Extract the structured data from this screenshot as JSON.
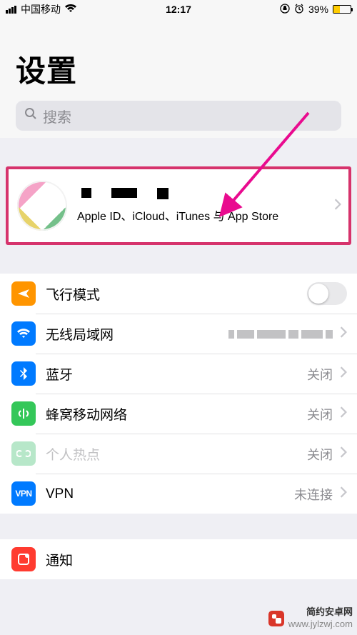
{
  "status": {
    "carrier": "中国移动",
    "signal_icon": "signal-icon",
    "wifi_icon": "wifi-icon",
    "time": "12:17",
    "lock_icon": "orientation-lock-icon",
    "alarm_icon": "alarm-icon",
    "battery_pct": "39%"
  },
  "header": {
    "title": "设置",
    "search_placeholder": "搜索"
  },
  "apple_id": {
    "subtitle": "Apple ID、iCloud、iTunes 与 App Store"
  },
  "rows": {
    "airplane": {
      "label": "飞行模式"
    },
    "wifi": {
      "label": "无线局域网"
    },
    "bluetooth": {
      "label": "蓝牙",
      "value": "关闭"
    },
    "cellular": {
      "label": "蜂窝移动网络",
      "value": "关闭"
    },
    "hotspot": {
      "label": "个人热点",
      "value": "关闭"
    },
    "vpn": {
      "label": "VPN",
      "icon_text": "VPN",
      "value": "未连接"
    },
    "notif": {
      "label": "通知"
    }
  },
  "watermark": {
    "brand": "简约安卓网",
    "url": "www.jylzwj.com"
  }
}
